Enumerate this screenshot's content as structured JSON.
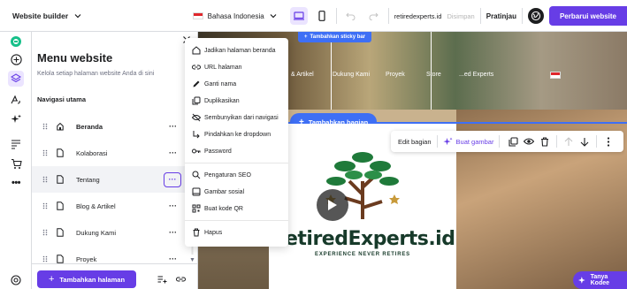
{
  "topbar": {
    "builder_label": "Website builder",
    "language": "Bahasa Indonesia",
    "domain": "retiredexperts.id",
    "saved_status": "Disimpan",
    "preview_label": "Pratinjau",
    "update_label": "Perbarui website"
  },
  "panel": {
    "title": "Menu website",
    "subtitle": "Kelola setiap halaman website Anda di sini",
    "nav_heading": "Navigasi utama",
    "items": [
      {
        "label": "Beranda",
        "icon": "home-icon"
      },
      {
        "label": "Kolaborasi",
        "icon": "page-icon"
      },
      {
        "label": "Tentang",
        "icon": "page-icon"
      },
      {
        "label": "Blog & Artikel",
        "icon": "page-icon"
      },
      {
        "label": "Dukung Kami",
        "icon": "page-icon"
      },
      {
        "label": "Proyek",
        "icon": "page-icon"
      }
    ],
    "add_page_label": "Tambahkan halaman"
  },
  "dropdown": {
    "items": [
      {
        "label": "Jadikan halaman beranda",
        "icon": "home-icon"
      },
      {
        "label": "URL halaman",
        "icon": "link-icon"
      },
      {
        "label": "Ganti nama",
        "icon": "pencil-icon"
      },
      {
        "label": "Duplikasikan",
        "icon": "copy-icon"
      },
      {
        "label": "Sembunyikan dari navigasi",
        "icon": "eye-off-icon"
      },
      {
        "label": "Pindahkan ke dropdown",
        "icon": "arrow-turn-icon"
      },
      {
        "label": "Password",
        "icon": "key-icon"
      },
      {
        "label": "Pengaturan SEO",
        "icon": "search-icon"
      },
      {
        "label": "Gambar sosial",
        "icon": "image-icon"
      },
      {
        "label": "Buat kode QR",
        "icon": "qr-icon"
      },
      {
        "label": "Hapus",
        "icon": "trash-icon"
      }
    ]
  },
  "canvas": {
    "sticky_bar_label": "Tambahkan sticky bar",
    "site_nav": [
      "& Artikel",
      "Dukung Kami",
      "Proyek",
      "Store",
      "...ed Experts"
    ],
    "add_section_label": "Tambahkan bagian",
    "toolbar": {
      "edit_section": "Edit bagian",
      "make_image": "Buat gambar"
    },
    "logo_text": "RetiredExperts.id",
    "logo_tagline": "EXPERIENCE NEVER RETIRES"
  },
  "chat": {
    "label": "Tanya Kodee"
  },
  "colors": {
    "accent": "#673de6",
    "accent_light": "#ebe4ff",
    "blue": "#3e6ff5"
  }
}
